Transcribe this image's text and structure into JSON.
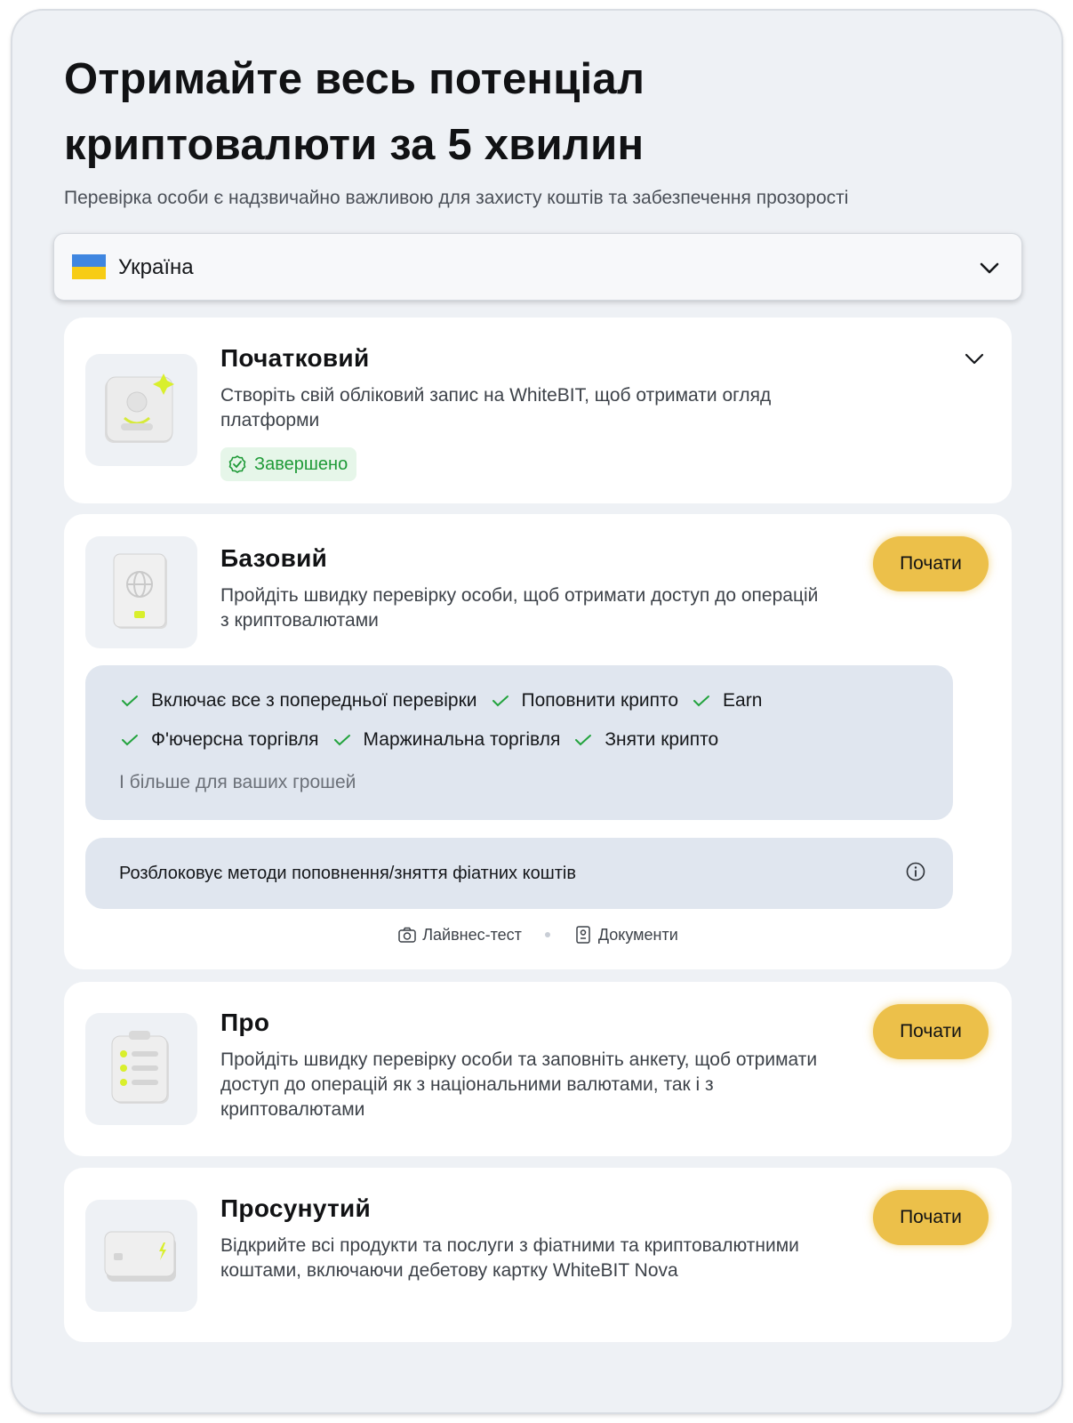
{
  "header": {
    "title": "Отримайте весь потенціал криптовалюти за 5 хвилин",
    "subtitle": "Перевірка особи є надзвичайно важливою для захисту коштів та забезпечення прозорості"
  },
  "country_select": {
    "selected": "Україна",
    "flag_icon": "ukraine-flag-icon",
    "flag_colors": [
      "#3f86e0",
      "#f7cc15"
    ]
  },
  "levels": {
    "initial": {
      "title": "Початковий",
      "description": "Створіть свій обліковий запис на WhiteBIT, щоб отримати огляд платформи",
      "status": "Завершено",
      "icon": "profile-card-icon"
    },
    "basic": {
      "title": "Базовий",
      "description": "Пройдіть швидку перевірку особи, щоб отримати доступ до операцій з криптовалютами",
      "button": "Почати",
      "icon": "passport-icon",
      "features": [
        "Включає все з попередньої перевірки",
        "Поповнити крипто",
        "Earn",
        "Ф'ючерсна торгівля",
        "Маржинальна торгівля",
        "Зняти крипто"
      ],
      "more": "І більше для ваших грошей",
      "fiat_note": "Розблоковує методи поповнення/зняття фіатних коштів",
      "requirements": [
        "Лайвнес-тест",
        "Документи"
      ]
    },
    "pro": {
      "title": "Про",
      "description": "Пройдіть швидку перевірку особи та заповніть анкету, щоб отримати доступ до операцій як з національними валютами, так і з криптовалютами",
      "button": "Почати",
      "icon": "checklist-icon"
    },
    "advanced": {
      "title": "Просунутий",
      "description": "Відкрийте всі продукти та послуги з фіатними та криптовалютними коштами, включаючи дебетову картку WhiteBIT Nova",
      "button": "Почати",
      "icon": "debit-card-icon"
    }
  },
  "colors": {
    "accent": "#ecc04a",
    "success": "#1e9a37",
    "panel": "#e0e6ef",
    "background": "#eef1f5"
  }
}
